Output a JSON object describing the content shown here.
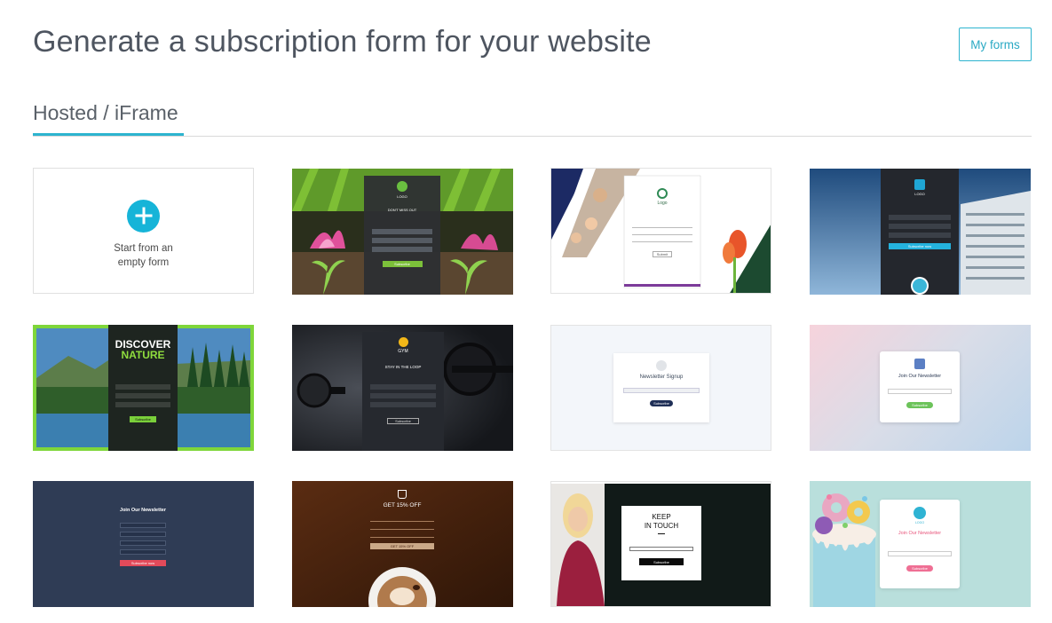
{
  "page": {
    "title": "Generate a subscription form for your website",
    "my_forms_label": "My forms"
  },
  "tabs": [
    {
      "label": "Hosted / iFrame",
      "active": true
    }
  ],
  "empty_card": {
    "line1": "Start from an",
    "line2": "empty form"
  },
  "templates": {
    "t1": {
      "logo": "LOGO",
      "heading": "DON'T MISS OUT",
      "button": "Subscribe"
    },
    "t2": {
      "logo": "Logo",
      "button": "Submit"
    },
    "t3": {
      "logo": "LOGO",
      "button": "Subscribe now"
    },
    "t4": {
      "heading_line1": "DISCOVER",
      "heading_line2": "NATURE",
      "button": "Subscribe"
    },
    "t5": {
      "logo": "GYM",
      "heading": "STAY IN THE LOOP",
      "button": "Subscribe"
    },
    "t6": {
      "heading": "Newsletter Signup",
      "button": "Subscribe"
    },
    "t7": {
      "heading": "Join Our Newsletter",
      "button": "Subscribe"
    },
    "t8": {
      "heading": "Join Our Newsletter",
      "button": "Subscribe now"
    },
    "t9": {
      "heading": "GET 15% OFF",
      "button": "GET 15% OFF"
    },
    "t10": {
      "heading_line1": "KEEP",
      "heading_line2": "IN TOUCH",
      "button": "Subscribe"
    },
    "t11": {
      "logo": "LOGO",
      "heading": "Join Our Newsletter",
      "button": "Subscribe"
    }
  },
  "colors": {
    "accent": "#2db4cf",
    "plus": "#16b4d8"
  }
}
